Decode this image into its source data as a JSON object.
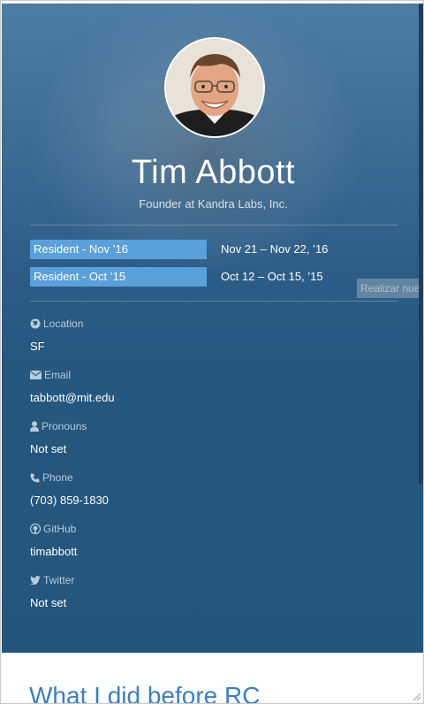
{
  "profile": {
    "name": "Tim Abbott",
    "subtitle": "Founder at Kandra Labs, Inc."
  },
  "residencies": [
    {
      "badge": "Resident - Nov ’16",
      "dates": "Nov 21 – Nov 22, ’16"
    },
    {
      "badge": "Resident - Oct ’15",
      "dates": "Oct 12 – Oct 15, ’15"
    }
  ],
  "tooltip": "Realizar nue",
  "fields": [
    {
      "label": "Location",
      "value": "SF",
      "icon": "globe-icon"
    },
    {
      "label": "Email",
      "value": "tabbott@mit.edu",
      "icon": "envelope-icon"
    },
    {
      "label": "Pronouns",
      "value": "Not set",
      "icon": "user-icon"
    },
    {
      "label": "Phone",
      "value": "(703) 859-1830",
      "icon": "phone-icon"
    },
    {
      "label": "GitHub",
      "value": "timabbott",
      "icon": "github-icon"
    },
    {
      "label": "Twitter",
      "value": "Not set",
      "icon": "twitter-icon"
    }
  ],
  "section": {
    "title": "What I did before RC"
  },
  "colors": {
    "hero": "#23557d",
    "badge": "#5aa0da",
    "accent": "#3b7fc1"
  }
}
